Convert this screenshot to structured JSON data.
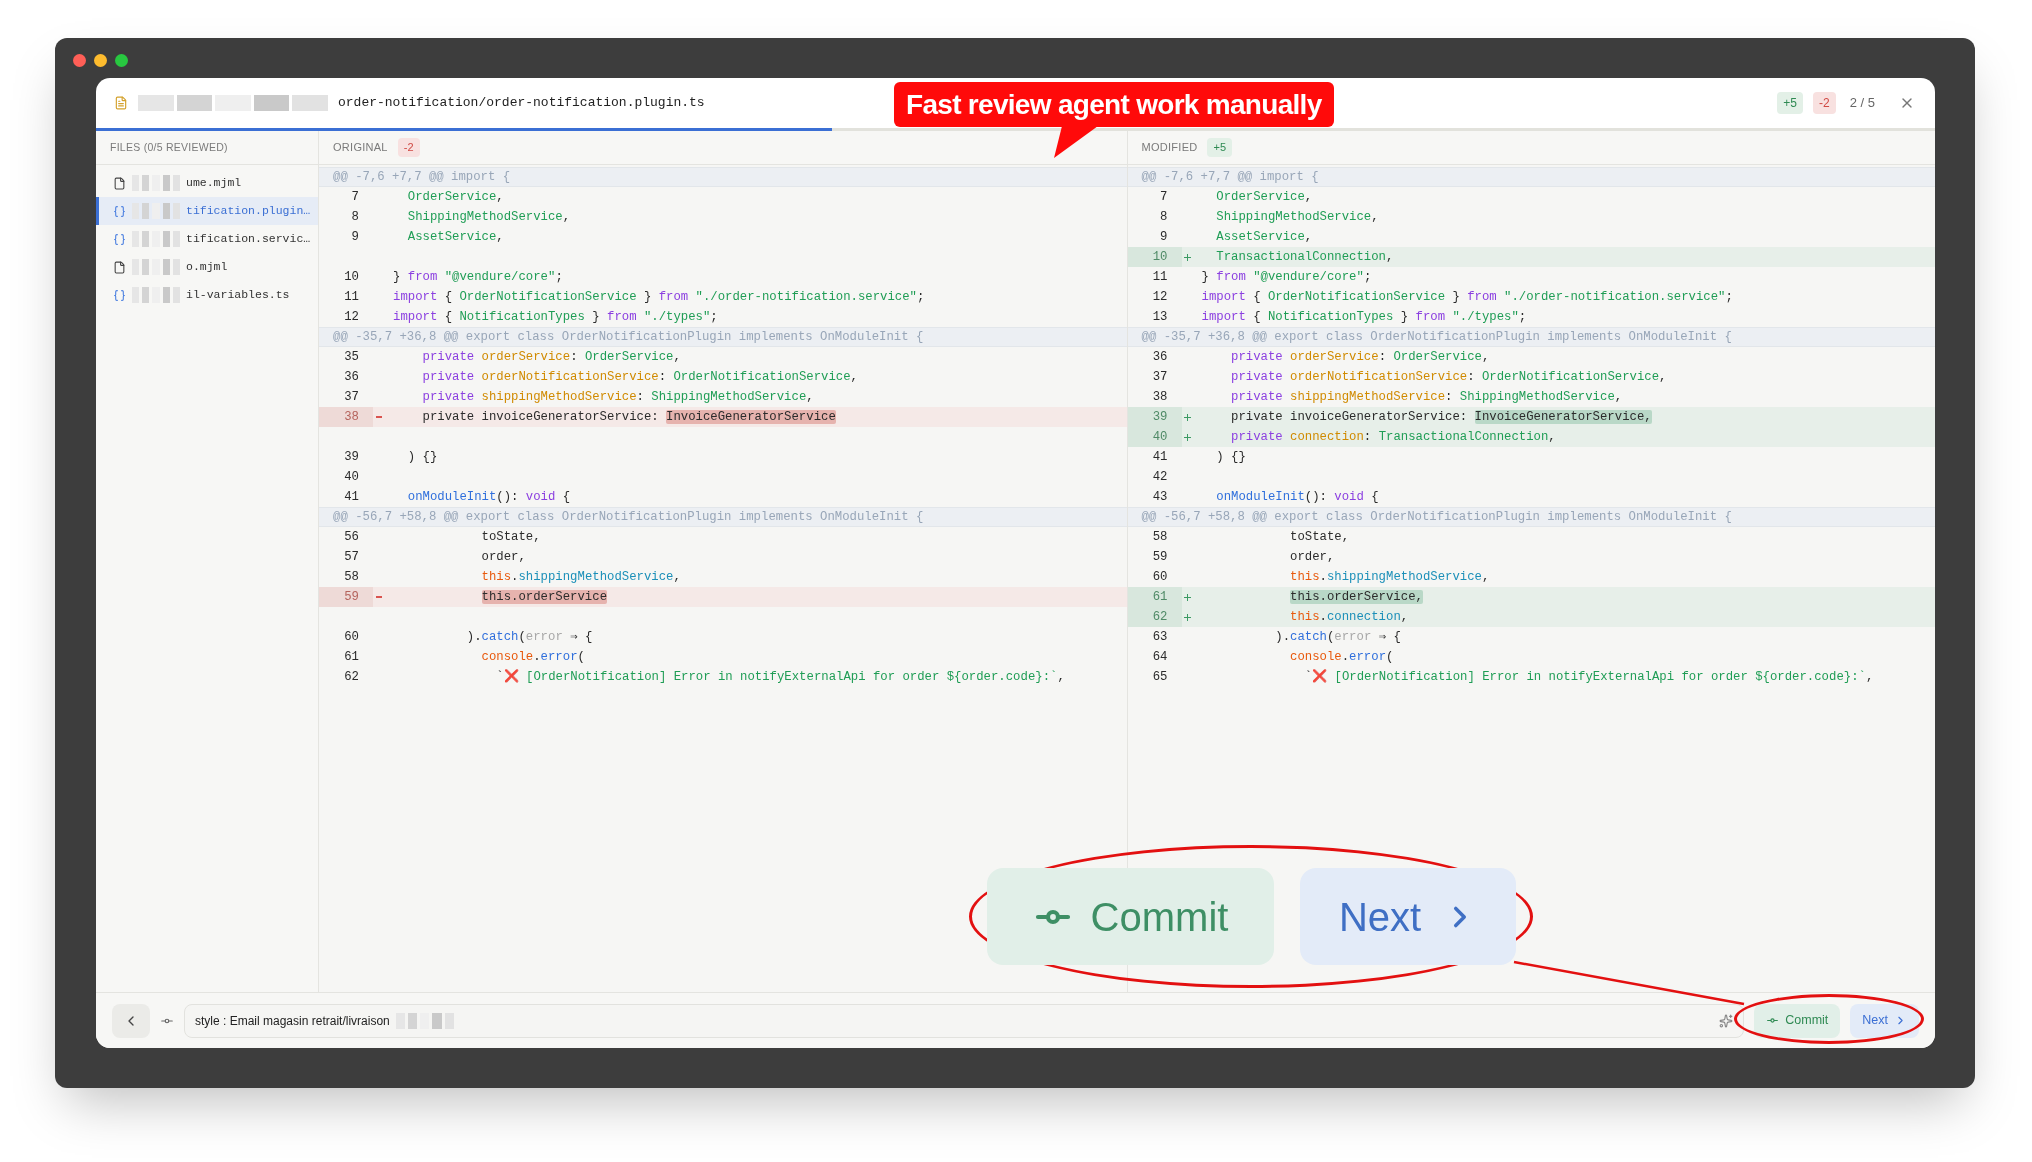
{
  "header": {
    "path": "order-notification/order-notification.plugin.ts",
    "added": "+5",
    "removed": "-2",
    "position": "2 / 5",
    "progress": {
      "level": 0.4
    }
  },
  "sidebar": {
    "title": "FILES (0/5 REVIEWED)",
    "files": [
      {
        "kind": "file",
        "name": "ume.mjml",
        "selected": false
      },
      {
        "kind": "code",
        "name": "tification.plugin…",
        "selected": true
      },
      {
        "kind": "code",
        "name": "tification.servic…",
        "selected": false
      },
      {
        "kind": "file",
        "name": "o.mjml",
        "selected": false
      },
      {
        "kind": "code",
        "name": "il-variables.ts",
        "selected": false
      }
    ]
  },
  "panes": [
    {
      "title": "ORIGINAL",
      "badge": "-2",
      "kind": "removed",
      "rows": [
        {
          "kind": "hunk",
          "text": "@@ -7,6 +7,7 @@ import {"
        },
        {
          "kind": "context",
          "num": "7",
          "tokens": [
            {
              "kind": "type",
              "text": "  OrderService"
            },
            {
              "kind": "plain",
              "text": ","
            }
          ]
        },
        {
          "kind": "context",
          "num": "8",
          "tokens": [
            {
              "kind": "type",
              "text": "  ShippingMethodService"
            },
            {
              "kind": "plain",
              "text": ","
            }
          ]
        },
        {
          "kind": "context",
          "num": "9",
          "tokens": [
            {
              "kind": "type",
              "text": "  AssetService"
            },
            {
              "kind": "plain",
              "text": ","
            }
          ]
        },
        {
          "kind": "empty"
        },
        {
          "kind": "context",
          "num": "10",
          "tokens": [
            {
              "kind": "plain",
              "text": "} "
            },
            {
              "kind": "keyword",
              "text": "from "
            },
            {
              "kind": "string",
              "text": "\"@vendure/core\""
            },
            {
              "kind": "plain",
              "text": ";"
            }
          ]
        },
        {
          "kind": "context",
          "num": "11",
          "tokens": [
            {
              "kind": "keyword",
              "text": "import "
            },
            {
              "kind": "plain",
              "text": "{ "
            },
            {
              "kind": "type",
              "text": "OrderNotificationService"
            },
            {
              "kind": "plain",
              "text": " } "
            },
            {
              "kind": "keyword",
              "text": "from "
            },
            {
              "kind": "string",
              "text": "\"./order-notification.service\""
            },
            {
              "kind": "plain",
              "text": ";"
            }
          ]
        },
        {
          "kind": "context",
          "num": "12",
          "tokens": [
            {
              "kind": "keyword",
              "text": "import "
            },
            {
              "kind": "plain",
              "text": "{ "
            },
            {
              "kind": "type",
              "text": "NotificationTypes"
            },
            {
              "kind": "plain",
              "text": " } "
            },
            {
              "kind": "keyword",
              "text": "from "
            },
            {
              "kind": "string",
              "text": "\"./types\""
            },
            {
              "kind": "plain",
              "text": ";"
            }
          ]
        },
        {
          "kind": "hunk",
          "text": "@@ -35,7 +36,8 @@ export class OrderNotificationPlugin implements OnModuleInit {"
        },
        {
          "kind": "context",
          "num": "35",
          "tokens": [
            {
              "kind": "keyword",
              "text": "    private "
            },
            {
              "kind": "property",
              "text": "orderService"
            },
            {
              "kind": "plain",
              "text": ": "
            },
            {
              "kind": "type",
              "text": "OrderService"
            },
            {
              "kind": "plain",
              "text": ","
            }
          ]
        },
        {
          "kind": "context",
          "num": "36",
          "tokens": [
            {
              "kind": "keyword",
              "text": "    private "
            },
            {
              "kind": "property",
              "text": "orderNotificationService"
            },
            {
              "kind": "plain",
              "text": ": "
            },
            {
              "kind": "type",
              "text": "OrderNotificationService"
            },
            {
              "kind": "plain",
              "text": ","
            }
          ]
        },
        {
          "kind": "context",
          "num": "37",
          "tokens": [
            {
              "kind": "keyword",
              "text": "    private "
            },
            {
              "kind": "property",
              "text": "shippingMethodService"
            },
            {
              "kind": "plain",
              "text": ": "
            },
            {
              "kind": "type",
              "text": "ShippingMethodService"
            },
            {
              "kind": "plain",
              "text": ","
            }
          ]
        },
        {
          "kind": "removed",
          "num": "38",
          "tokens": [
            {
              "kind": "plain",
              "text": "    private invoiceGeneratorService: "
            },
            {
              "kind": "highlight",
              "text": "InvoiceGeneratorService"
            }
          ]
        },
        {
          "kind": "empty"
        },
        {
          "kind": "context",
          "num": "39",
          "tokens": [
            {
              "kind": "plain",
              "text": "  ) {}"
            }
          ]
        },
        {
          "kind": "context",
          "num": "40"
        },
        {
          "kind": "context",
          "num": "41",
          "tokens": [
            {
              "kind": "function",
              "text": "  onModuleInit"
            },
            {
              "kind": "plain",
              "text": "(): "
            },
            {
              "kind": "keyword",
              "text": "void"
            },
            {
              "kind": "plain",
              "text": " {"
            }
          ]
        },
        {
          "kind": "hunk",
          "text": "@@ -56,7 +58,8 @@ export class OrderNotificationPlugin implements OnModuleInit {"
        },
        {
          "kind": "context",
          "num": "56",
          "tokens": [
            {
              "kind": "plain",
              "text": "            toState,"
            }
          ]
        },
        {
          "kind": "context",
          "num": "57",
          "tokens": [
            {
              "kind": "plain",
              "text": "            order,"
            }
          ]
        },
        {
          "kind": "context",
          "num": "58",
          "tokens": [
            {
              "kind": "object",
              "text": "            this"
            },
            {
              "kind": "plain",
              "text": "."
            },
            {
              "kind": "member",
              "text": "shippingMethodService"
            },
            {
              "kind": "plain",
              "text": ","
            }
          ]
        },
        {
          "kind": "removed",
          "num": "59",
          "tokens": [
            {
              "kind": "highlight",
              "text": "            this.orderService"
            }
          ]
        },
        {
          "kind": "empty"
        },
        {
          "kind": "context",
          "num": "60",
          "tokens": [
            {
              "kind": "plain",
              "text": "          )."
            },
            {
              "kind": "function",
              "text": "catch"
            },
            {
              "kind": "plain",
              "text": "("
            },
            {
              "kind": "faded",
              "text": "error"
            },
            {
              "kind": "plain",
              "text": " ⇒ {"
            }
          ]
        },
        {
          "kind": "context",
          "num": "61",
          "tokens": [
            {
              "kind": "object",
              "text": "            console"
            },
            {
              "kind": "plain",
              "text": "."
            },
            {
              "kind": "function",
              "text": "error"
            },
            {
              "kind": "plain",
              "text": "("
            }
          ]
        },
        {
          "kind": "context",
          "num": "62",
          "tokens": [
            {
              "kind": "plain",
              "text": "              `"
            },
            {
              "kind": "emoji",
              "text": "❌"
            },
            {
              "kind": "string",
              "text": " [OrderNotification] Error in notifyExternalApi for order ${order.code}:`"
            },
            {
              "kind": "plain",
              "text": ","
            }
          ]
        }
      ]
    },
    {
      "title": "MODIFIED",
      "badge": "+5",
      "kind": "added",
      "rows": [
        {
          "kind": "hunk",
          "text": "@@ -7,6 +7,7 @@ import {"
        },
        {
          "kind": "context",
          "num": "7",
          "tokens": [
            {
              "kind": "type",
              "text": "  OrderService"
            },
            {
              "kind": "plain",
              "text": ","
            }
          ]
        },
        {
          "kind": "context",
          "num": "8",
          "tokens": [
            {
              "kind": "type",
              "text": "  ShippingMethodService"
            },
            {
              "kind": "plain",
              "text": ","
            }
          ]
        },
        {
          "kind": "context",
          "num": "9",
          "tokens": [
            {
              "kind": "type",
              "text": "  AssetService"
            },
            {
              "kind": "plain",
              "text": ","
            }
          ]
        },
        {
          "kind": "added",
          "num": "10",
          "tokens": [
            {
              "kind": "type",
              "text": "  TransactionalConnection"
            },
            {
              "kind": "plain",
              "text": ","
            }
          ]
        },
        {
          "kind": "context",
          "num": "11",
          "tokens": [
            {
              "kind": "plain",
              "text": "} "
            },
            {
              "kind": "keyword",
              "text": "from "
            },
            {
              "kind": "string",
              "text": "\"@vendure/core\""
            },
            {
              "kind": "plain",
              "text": ";"
            }
          ]
        },
        {
          "kind": "context",
          "num": "12",
          "tokens": [
            {
              "kind": "keyword",
              "text": "import "
            },
            {
              "kind": "plain",
              "text": "{ "
            },
            {
              "kind": "type",
              "text": "OrderNotificationService"
            },
            {
              "kind": "plain",
              "text": " } "
            },
            {
              "kind": "keyword",
              "text": "from "
            },
            {
              "kind": "string",
              "text": "\"./order-notification.service\""
            },
            {
              "kind": "plain",
              "text": ";"
            }
          ]
        },
        {
          "kind": "context",
          "num": "13",
          "tokens": [
            {
              "kind": "keyword",
              "text": "import "
            },
            {
              "kind": "plain",
              "text": "{ "
            },
            {
              "kind": "type",
              "text": "NotificationTypes"
            },
            {
              "kind": "plain",
              "text": " } "
            },
            {
              "kind": "keyword",
              "text": "from "
            },
            {
              "kind": "string",
              "text": "\"./types\""
            },
            {
              "kind": "plain",
              "text": ";"
            }
          ]
        },
        {
          "kind": "hunk",
          "text": "@@ -35,7 +36,8 @@ export class OrderNotificationPlugin implements OnModuleInit {"
        },
        {
          "kind": "context",
          "num": "36",
          "tokens": [
            {
              "kind": "keyword",
              "text": "    private "
            },
            {
              "kind": "property",
              "text": "orderService"
            },
            {
              "kind": "plain",
              "text": ": "
            },
            {
              "kind": "type",
              "text": "OrderService"
            },
            {
              "kind": "plain",
              "text": ","
            }
          ]
        },
        {
          "kind": "context",
          "num": "37",
          "tokens": [
            {
              "kind": "keyword",
              "text": "    private "
            },
            {
              "kind": "property",
              "text": "orderNotificationService"
            },
            {
              "kind": "plain",
              "text": ": "
            },
            {
              "kind": "type",
              "text": "OrderNotificationService"
            },
            {
              "kind": "plain",
              "text": ","
            }
          ]
        },
        {
          "kind": "context",
          "num": "38",
          "tokens": [
            {
              "kind": "keyword",
              "text": "    private "
            },
            {
              "kind": "property",
              "text": "shippingMethodService"
            },
            {
              "kind": "plain",
              "text": ": "
            },
            {
              "kind": "type",
              "text": "ShippingMethodService"
            },
            {
              "kind": "plain",
              "text": ","
            }
          ]
        },
        {
          "kind": "added",
          "num": "39",
          "tokens": [
            {
              "kind": "plain",
              "text": "    private invoiceGeneratorService: "
            },
            {
              "kind": "highlight",
              "text": "InvoiceGeneratorService,"
            }
          ]
        },
        {
          "kind": "added",
          "num": "40",
          "tokens": [
            {
              "kind": "keyword",
              "text": "    private "
            },
            {
              "kind": "property",
              "text": "connection"
            },
            {
              "kind": "plain",
              "text": ": "
            },
            {
              "kind": "type",
              "text": "TransactionalConnection"
            },
            {
              "kind": "plain",
              "text": ","
            }
          ]
        },
        {
          "kind": "context",
          "num": "41",
          "tokens": [
            {
              "kind": "plain",
              "text": "  ) {}"
            }
          ]
        },
        {
          "kind": "context",
          "num": "42"
        },
        {
          "kind": "context",
          "num": "43",
          "tokens": [
            {
              "kind": "function",
              "text": "  onModuleInit"
            },
            {
              "kind": "plain",
              "text": "(): "
            },
            {
              "kind": "keyword",
              "text": "void"
            },
            {
              "kind": "plain",
              "text": " {"
            }
          ]
        },
        {
          "kind": "hunk",
          "text": "@@ -56,7 +58,8 @@ export class OrderNotificationPlugin implements OnModuleInit {"
        },
        {
          "kind": "context",
          "num": "58",
          "tokens": [
            {
              "kind": "plain",
              "text": "            toState,"
            }
          ]
        },
        {
          "kind": "context",
          "num": "59",
          "tokens": [
            {
              "kind": "plain",
              "text": "            order,"
            }
          ]
        },
        {
          "kind": "context",
          "num": "60",
          "tokens": [
            {
              "kind": "object",
              "text": "            this"
            },
            {
              "kind": "plain",
              "text": "."
            },
            {
              "kind": "member",
              "text": "shippingMethodService"
            },
            {
              "kind": "plain",
              "text": ","
            }
          ]
        },
        {
          "kind": "added",
          "num": "61",
          "tokens": [
            {
              "kind": "highlight",
              "text": "            this.orderService,"
            }
          ]
        },
        {
          "kind": "added",
          "num": "62",
          "tokens": [
            {
              "kind": "object",
              "text": "            this"
            },
            {
              "kind": "plain",
              "text": "."
            },
            {
              "kind": "member",
              "text": "connection"
            },
            {
              "kind": "plain",
              "text": ","
            }
          ]
        },
        {
          "kind": "context",
          "num": "63",
          "tokens": [
            {
              "kind": "plain",
              "text": "          )."
            },
            {
              "kind": "function",
              "text": "catch"
            },
            {
              "kind": "plain",
              "text": "("
            },
            {
              "kind": "faded",
              "text": "error"
            },
            {
              "kind": "plain",
              "text": " ⇒ {"
            }
          ]
        },
        {
          "kind": "context",
          "num": "64",
          "tokens": [
            {
              "kind": "object",
              "text": "            console"
            },
            {
              "kind": "plain",
              "text": "."
            },
            {
              "kind": "function",
              "text": "error"
            },
            {
              "kind": "plain",
              "text": "("
            }
          ]
        },
        {
          "kind": "context",
          "num": "65",
          "tokens": [
            {
              "kind": "plain",
              "text": "              `"
            },
            {
              "kind": "emoji",
              "text": "❌"
            },
            {
              "kind": "string",
              "text": " [OrderNotification] Error in notifyExternalApi for order ${order.code}:`"
            },
            {
              "kind": "plain",
              "text": ","
            }
          ]
        }
      ]
    }
  ],
  "footer": {
    "commit_message": "style : Email magasin retrait/livraison",
    "commit_button": "Commit",
    "next_button": "Next"
  },
  "annotation": {
    "callout": "Fast review agent work manually",
    "zoom_commit": "Commit",
    "zoom_next": "Next"
  }
}
